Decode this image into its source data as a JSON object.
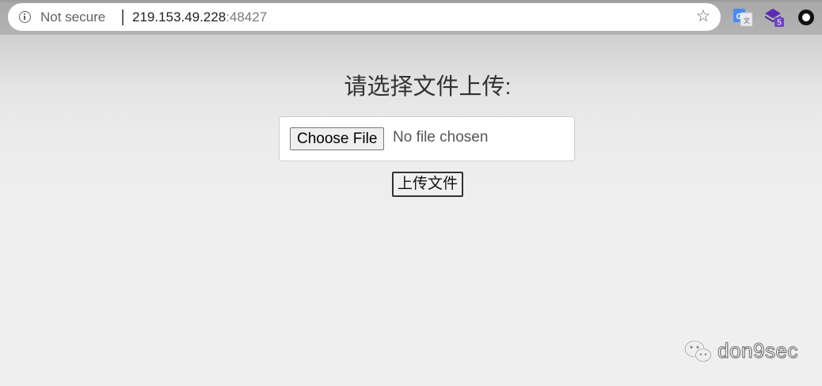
{
  "browser": {
    "security_label": "Not secure",
    "url_host": "219.153.49.228",
    "url_port": ":48427",
    "extensions": [
      {
        "icon": "translate-icon"
      },
      {
        "icon": "stack-extension-icon",
        "badge": "5"
      },
      {
        "icon": "circle-extension-icon"
      }
    ]
  },
  "page": {
    "heading": "请选择文件上传:",
    "file_input": {
      "button_label": "Choose File",
      "status": "No file chosen"
    },
    "upload_button_label": "上传文件"
  },
  "watermark": {
    "text": "don9sec"
  },
  "colors": {
    "heading": "#333333",
    "extension_purple": "#5b2bb5",
    "translate_blue": "#4a8af4"
  }
}
